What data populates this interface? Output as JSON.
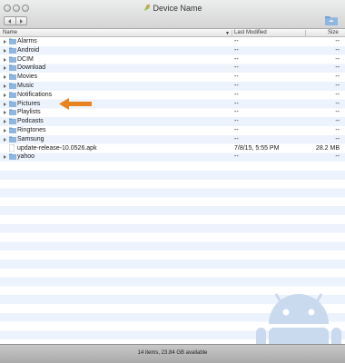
{
  "window": {
    "title": "Device Name"
  },
  "columns": {
    "name": "Name",
    "sort_indicator": "▼",
    "last_modified": "Last Modified",
    "size": "Size"
  },
  "items": [
    {
      "name": "Alarms",
      "type": "folder",
      "modified": "--",
      "size": "--"
    },
    {
      "name": "Android",
      "type": "folder",
      "modified": "--",
      "size": "--"
    },
    {
      "name": "DCIM",
      "type": "folder",
      "modified": "--",
      "size": "--"
    },
    {
      "name": "Download",
      "type": "folder",
      "modified": "--",
      "size": "--"
    },
    {
      "name": "Movies",
      "type": "folder",
      "modified": "--",
      "size": "--"
    },
    {
      "name": "Music",
      "type": "folder",
      "modified": "--",
      "size": "--"
    },
    {
      "name": "Notifications",
      "type": "folder",
      "modified": "--",
      "size": "--"
    },
    {
      "name": "Pictures",
      "type": "folder",
      "modified": "--",
      "size": "--"
    },
    {
      "name": "Playlists",
      "type": "folder",
      "modified": "--",
      "size": "--"
    },
    {
      "name": "Podcasts",
      "type": "folder",
      "modified": "--",
      "size": "--"
    },
    {
      "name": "Ringtones",
      "type": "folder",
      "modified": "--",
      "size": "--"
    },
    {
      "name": "Samsung",
      "type": "folder",
      "modified": "--",
      "size": "--"
    },
    {
      "name": "update-release-10.0526.apk",
      "type": "file",
      "modified": "7/8/15, 5:55 PM",
      "size": "28.2 MB"
    },
    {
      "name": "yahoo",
      "type": "folder",
      "modified": "--",
      "size": "--"
    }
  ],
  "status": {
    "text": "14 items, 23.84 GB available"
  },
  "annotation": {
    "arrow_target": "Pictures",
    "arrow_color": "#e8821e"
  },
  "colors": {
    "folder": "#8fb6e0",
    "android": "#c9d9ee",
    "stripe": "#edf3fc"
  },
  "icons": [
    "app-icon",
    "back-icon",
    "forward-icon",
    "new-folder-icon",
    "disclosure-triangle-icon",
    "folder-icon",
    "file-icon",
    "android-logo",
    "arrow-icon"
  ]
}
